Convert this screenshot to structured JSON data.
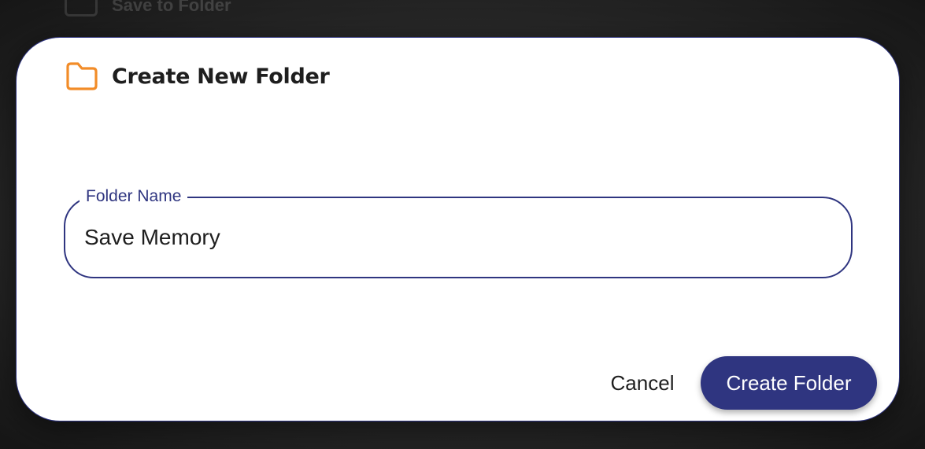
{
  "background": {
    "hint_icon": "folder-icon",
    "hint_text": "Save to Folder"
  },
  "dialog": {
    "icon": "folder-outline-icon",
    "icon_color": "#F28C28",
    "title": "Create New Folder",
    "field": {
      "label": "Folder Name",
      "value": "Save Memory",
      "placeholder": ""
    },
    "actions": {
      "cancel_label": "Cancel",
      "create_label": "Create Folder"
    }
  },
  "colors": {
    "accent": "#2F3580",
    "dialog_background": "#FFFFFF",
    "backdrop": "#2A2A2A"
  }
}
